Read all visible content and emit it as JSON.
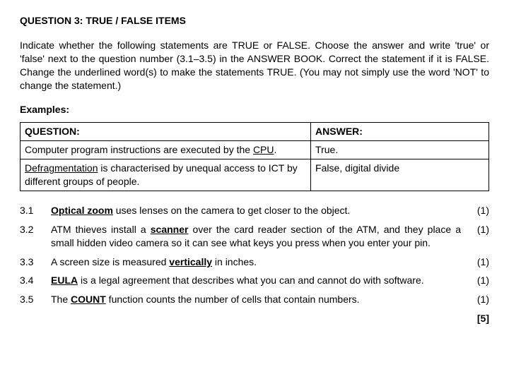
{
  "title": "QUESTION 3: TRUE / FALSE ITEMS",
  "instructions": "Indicate whether the following statements are TRUE or FALSE. Choose the answer and write 'true' or 'false' next to the question number (3.1–3.5) in the ANSWER BOOK. Correct the statement if it is FALSE. Change the underlined word(s) to make the statements TRUE. (You may not simply use the word 'NOT' to change the statement.)",
  "examples_label": "Examples:",
  "table": {
    "header_q": "QUESTION:",
    "header_a": "ANSWER:",
    "row1_q_pre": "Computer program instructions are executed by the ",
    "row1_q_u": "CPU",
    "row1_q_post": ".",
    "row1_a": "True.",
    "row2_q_u": "Defragmentation",
    "row2_q_post": " is characterised by unequal access to ICT by different groups of people.",
    "row2_a": "False, digital divide"
  },
  "questions": [
    {
      "num": "3.1",
      "pre": "",
      "u": "Optical zoom",
      "post": " uses lenses on the camera to get closer to the object.",
      "marks": "(1)"
    },
    {
      "num": "3.2",
      "pre": "ATM thieves install a ",
      "u": "scanner",
      "post": " over the card reader section of the ATM, and they place a small hidden video camera so it can see what keys you press when you enter your pin.",
      "marks": "(1)"
    },
    {
      "num": "3.3",
      "pre": "A screen size is measured ",
      "u": "vertically",
      "post": " in inches.",
      "marks": "(1)"
    },
    {
      "num": "3.4",
      "pre": "",
      "u": "EULA",
      "post": " is a legal agreement that describes what you can and cannot do with software.",
      "marks": "(1)"
    },
    {
      "num": "3.5",
      "pre": "The ",
      "u": "COUNT",
      "post": " function counts the number of cells that contain numbers.",
      "marks": "(1)"
    }
  ],
  "total": "[5]"
}
